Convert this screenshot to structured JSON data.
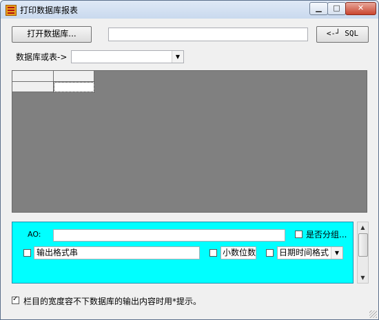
{
  "window": {
    "title": "打印数据库报表",
    "min_glyph": "▁",
    "max_glyph": "□",
    "close_glyph": "✕"
  },
  "toolbar": {
    "open_db_label": "打开数据库...",
    "sql_value": "",
    "sql_button_label": "<-┘ SQL"
  },
  "database": {
    "label": "数据库或表->",
    "selected_value": ""
  },
  "options": {
    "ao_label": "AO:",
    "ao_value": "",
    "grouping_label": "是否分组...",
    "grouping_checked": false,
    "format_checked": false,
    "format_value": "输出格式串",
    "decimal_checked": false,
    "decimal_label": "小数位数",
    "datetime_checked": false,
    "datetime_value": "日期时间格式"
  },
  "footer": {
    "hint_checked": true,
    "hint_label": "栏目的宽度容不下数据库的输出内容时用*提示。"
  },
  "colors": {
    "panel_bg": "#00ffff",
    "grid_bg": "#808080"
  }
}
